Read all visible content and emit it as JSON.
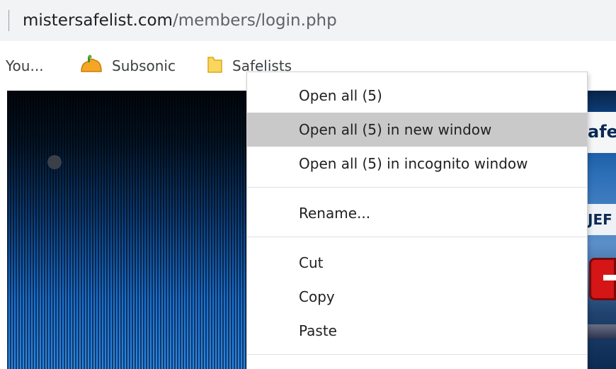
{
  "address_bar": {
    "url_domain": "mistersafelist.com",
    "url_path": "/members/login.php"
  },
  "bookmarks": [
    {
      "label": "You...",
      "icon": "none"
    },
    {
      "label": "Subsonic",
      "icon": "subsonic-icon"
    },
    {
      "label": "Safelists",
      "icon": "folder-icon"
    }
  ],
  "page": {
    "right_panel_text_1": "afel",
    "right_panel_text_2": "JEF"
  },
  "context_menu": {
    "items": [
      {
        "label": "Open all (5)",
        "hovered": false
      },
      {
        "label": "Open all (5) in new window",
        "hovered": true
      },
      {
        "label": "Open all (5) in incognito window",
        "hovered": false
      },
      {
        "label": "Rename...",
        "hovered": false
      },
      {
        "label": "Cut",
        "hovered": false
      },
      {
        "label": "Copy",
        "hovered": false
      },
      {
        "label": "Paste",
        "hovered": false
      }
    ]
  },
  "colors": {
    "address_bar_bg": "#f1f3f4",
    "menu_hover_bg": "#c9c9c9",
    "folder_yellow": "#f9d65e",
    "subsonic_orange": "#f5a623"
  }
}
